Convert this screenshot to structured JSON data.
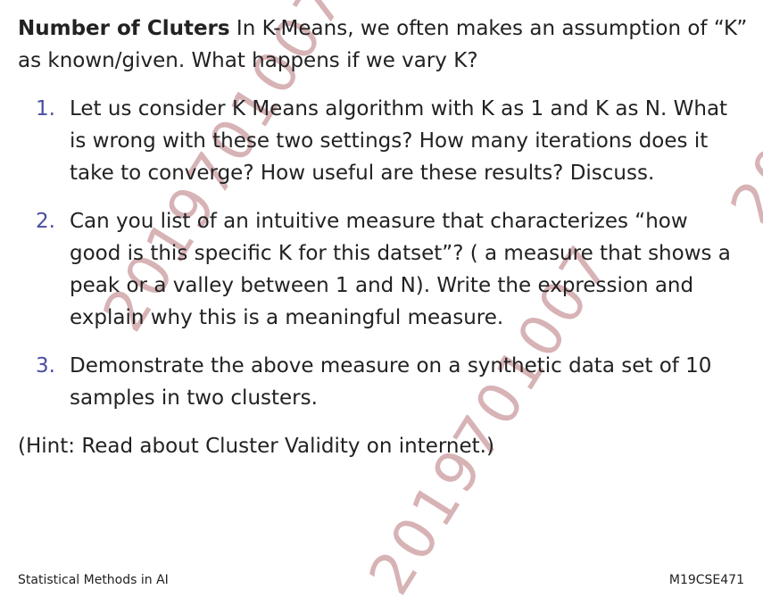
{
  "watermark": "2019701007",
  "heading": "Number of Cluters",
  "intro_text": "In K-Means, we often makes an assumption of “K” as known/given. What happens if we vary K?",
  "questions": [
    {
      "number": "1.",
      "text": "Let us consider K Means algorithm with K as 1 and K as N. What is wrong with these two settings? How many iterations does it take to converge? How useful are these results? Discuss."
    },
    {
      "number": "2.",
      "text": "Can you list of an intuitive measure that characterizes “how good is this specific K for this datset”? ( a measure that shows a peak or a valley between 1 and N). Write the expression and explain why this is a meaningful measure."
    },
    {
      "number": "3.",
      "text": "Demonstrate the above measure on a synthetic data set of 10 samples in two clusters."
    }
  ],
  "hint": "(Hint: Read about Cluster Validity on internet.)",
  "footer": {
    "left": "Statistical Methods in AI",
    "right": "M19CSE471"
  },
  "colors": {
    "watermark": "#d7b3b6",
    "list_number": "#4a4ea0",
    "text": "#222222"
  }
}
